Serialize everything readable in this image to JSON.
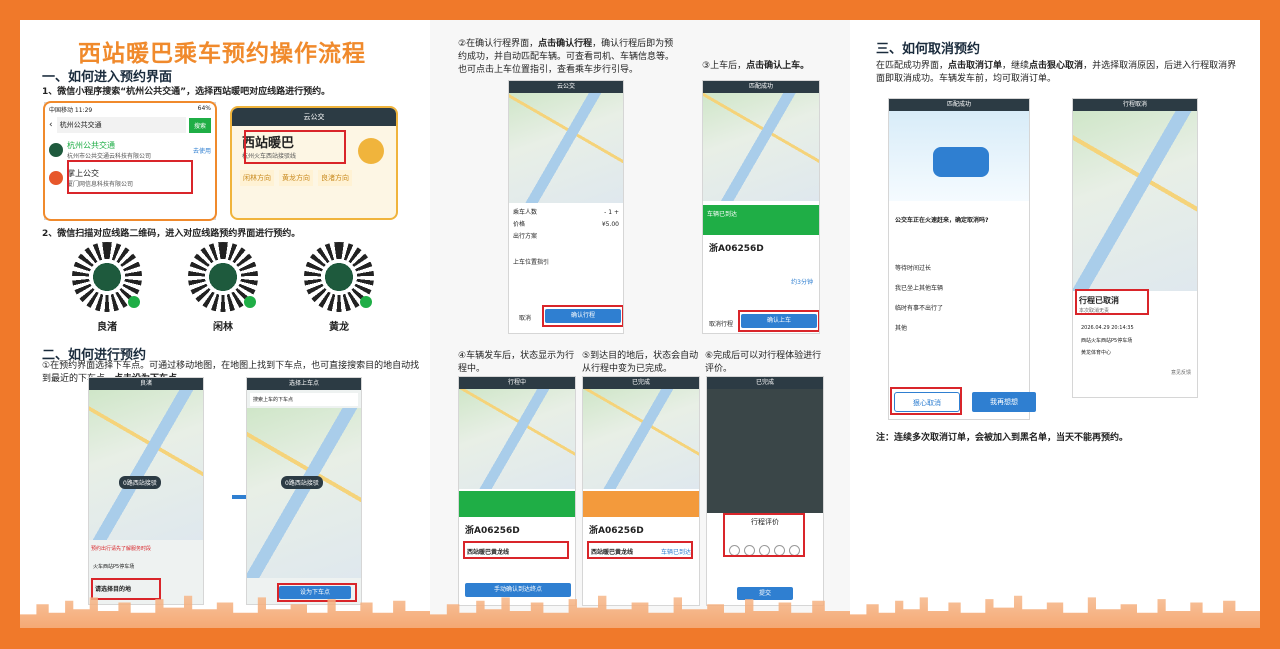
{
  "title": "西站暖巴乘车预约操作流程",
  "s1": {
    "head": "一、如何进入预约界面",
    "step1": "1、微信小程序搜索“杭州公共交通”，选择西站暖吧对应线路进行预约。",
    "step2": "2、微信扫描对应线路二维码，进入对应线路预约界面进行预约。"
  },
  "search": {
    "status": "中国移动 11:29",
    "battery": "64%",
    "query": "杭州公共交通",
    "btn": "搜索",
    "r1": "杭州公共交通",
    "r1sub": "杭州市公共交通云科技有限公司",
    "r1link": "去使用",
    "r2": "掌上公交",
    "r2sub": "厦门网信息科技有限公司"
  },
  "cloudbus": {
    "title": "云公交",
    "name": "西站暖巴",
    "sub": "杭州火车西站接驳线",
    "d1": "闲林方向",
    "d2": "黄龙方向",
    "d3": "良渚方向"
  },
  "qrs": [
    "良渚",
    "闲林",
    "黄龙"
  ],
  "s2": {
    "head": "二、如何进行预约",
    "desc": "①在预约界面选择下车点。可通过移动地图，在地图上找到下车点，也可直接搜索目的地自动找到最近的下车点，",
    "bold": "点击设为下车点。"
  },
  "ph1": {
    "title": "良渚",
    "pin": "0路西站接驳",
    "tip": "预约出行请先了解服务时段",
    "tabs": "火车西站P5停车场",
    "sel": "请选择目的地"
  },
  "ph2": {
    "title": "选择上车点",
    "search": "搜索上车的下车点",
    "pin": "0路西站接驳",
    "btn": "设为下车点"
  },
  "step2a": {
    "pre": "②在确认行程界面，",
    "b1": "点击确认行程",
    "mid": "，确认行程后即为预约成功，并自动匹配车辆。可查看司机、车辆信息等。也可点击上车位置指引，查看乘车步行引导。"
  },
  "ph3": {
    "title": "云公交",
    "seats": "乘车人数",
    "price": "¥5.00",
    "total": "价格",
    "plan": "出行方案",
    "guide": "上车位置指引",
    "btn": "确认行程",
    "cancel": "取消"
  },
  "step3": {
    "pre": "③上车后，",
    "b": "点击确认上车。"
  },
  "ph4": {
    "title": "匹配成功",
    "plate": "浙A06256D",
    "status": "车辆已到达",
    "time": "约3分钟",
    "btn": "确认上车",
    "cancel": "取消行程"
  },
  "step4": "④车辆发车后，状态显示为行程中。",
  "step5": "⑤到达目的地后，状态会自动从行程中变为已完成。",
  "step6": "⑥完成后可以对行程体验进行评价。",
  "ph5": {
    "title": "行程中",
    "plate": "浙A06256D",
    "route": "西站暖巴黄龙线",
    "btn": "手动确认到达终点"
  },
  "ph6": {
    "title": "已完成",
    "plate": "浙A06256D",
    "route": "西站暖巴黄龙线",
    "stat": "车辆已到达"
  },
  "ph7": {
    "title": "已完成",
    "rate": "行程评价",
    "btn": "提交"
  },
  "s3": {
    "head": "三、如何取消预约",
    "pre": "在匹配成功界面，",
    "b1": "点击取消订单",
    "mid": "，继续",
    "b2": "点击狠心取消",
    "post": "，并选择取消原因，后进入行程取消界面即取消成功。车辆发车前，均可取消订单。"
  },
  "ph8": {
    "title": "匹配成功",
    "q": "公交车正在火速赶来，确定取消吗?",
    "r1": "等待时间过长",
    "r2": "我已坐上其他车辆",
    "r3": "临时有事不出行了",
    "r4": "其他",
    "b1": "狠心取消",
    "b2": "我再想想"
  },
  "ph9": {
    "title": "行程取消",
    "cancel": "行程已取消",
    "sub": "本次取消无责",
    "time": "2026.04.29 20:14:35",
    "p1": "西站火车西站P5停车场",
    "p2": "黄龙体育中心",
    "fb": "意见反馈"
  },
  "note": "注：连续多次取消订单，会被加入到黑名单，当天不能再预约。"
}
